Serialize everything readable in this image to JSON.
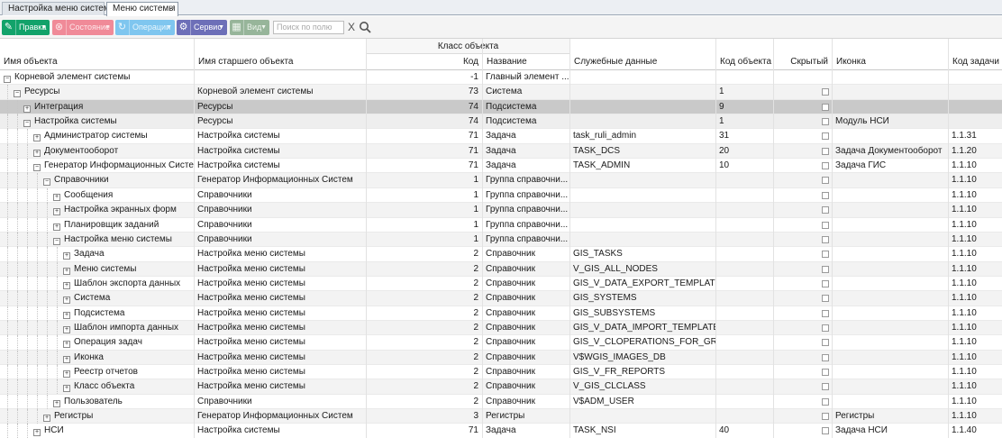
{
  "tabs": [
    {
      "label": "Настройка меню системы"
    },
    {
      "label": "Меню системы",
      "close": "×"
    }
  ],
  "toolbar": {
    "edit": "Правка",
    "state": "Состояние",
    "operations": "Операции",
    "service": "Сервис",
    "view": "Вид",
    "search_placeholder": "Поиск по полю",
    "clear": "X"
  },
  "grid": {
    "group_header": "Класс объекта",
    "columns": [
      "Имя объекта",
      "Имя старшего объекта",
      "Код",
      "Название",
      "Служебные данные",
      "Код объекта",
      "Скрытый",
      "Иконка",
      "Код задачи"
    ],
    "rows": [
      {
        "level": 0,
        "exp": "−",
        "name": "Корневой элемент системы",
        "parent": "",
        "code": "-1",
        "title": "Главный элемент ...",
        "service": "",
        "obj_code": "",
        "icon": "",
        "task": ""
      },
      {
        "level": 1,
        "exp": "−",
        "name": "Ресурсы",
        "parent": "Корневой элемент системы",
        "code": "73",
        "title": "Система",
        "service": "",
        "obj_code": "1",
        "icon": "",
        "task": ""
      },
      {
        "level": 2,
        "exp": "+",
        "name": "Интеграция",
        "parent": "Ресурсы",
        "code": "74",
        "title": "Подсистема",
        "service": "",
        "obj_code": "9",
        "icon": "",
        "task": ""
      },
      {
        "level": 2,
        "exp": "−",
        "name": "Настройка системы",
        "parent": "Ресурсы",
        "code": "74",
        "title": "Подсистема",
        "service": "",
        "obj_code": "1",
        "icon": "Модуль НСИ",
        "task": ""
      },
      {
        "level": 3,
        "exp": "+",
        "name": "Администратор системы",
        "parent": "Настройка системы",
        "code": "71",
        "title": "Задача",
        "service": "task_ruli_admin",
        "obj_code": "31",
        "icon": "",
        "task": "1.1.31"
      },
      {
        "level": 3,
        "exp": "+",
        "name": "Документооборот",
        "parent": "Настройка системы",
        "code": "71",
        "title": "Задача",
        "service": "TASK_DCS",
        "obj_code": "20",
        "icon": "Задача Документооборот",
        "task": "1.1.20"
      },
      {
        "level": 3,
        "exp": "−",
        "name": "Генератор Информационных Систем",
        "parent": "Настройка системы",
        "code": "71",
        "title": "Задача",
        "service": "TASK_ADMIN",
        "obj_code": "10",
        "icon": "Задача ГИС",
        "task": "1.1.10"
      },
      {
        "level": 4,
        "exp": "−",
        "name": "Справочники",
        "parent": "Генератор Информационных Систем",
        "code": "1",
        "title": "Группа справочни...",
        "service": "",
        "obj_code": "",
        "icon": "",
        "task": "1.1.10"
      },
      {
        "level": 5,
        "exp": "+",
        "name": "Сообщения",
        "parent": "Справочники",
        "code": "1",
        "title": "Группа справочни...",
        "service": "",
        "obj_code": "",
        "icon": "",
        "task": "1.1.10"
      },
      {
        "level": 5,
        "exp": "+",
        "name": "Настройка экранных форм",
        "parent": "Справочники",
        "code": "1",
        "title": "Группа справочни...",
        "service": "",
        "obj_code": "",
        "icon": "",
        "task": "1.1.10"
      },
      {
        "level": 5,
        "exp": "+",
        "name": "Планировщик заданий",
        "parent": "Справочники",
        "code": "1",
        "title": "Группа справочни...",
        "service": "",
        "obj_code": "",
        "icon": "",
        "task": "1.1.10"
      },
      {
        "level": 5,
        "exp": "−",
        "name": "Настройка меню системы",
        "parent": "Справочники",
        "code": "1",
        "title": "Группа справочни...",
        "service": "",
        "obj_code": "",
        "icon": "",
        "task": "1.1.10"
      },
      {
        "level": 6,
        "exp": "+",
        "name": "Задача",
        "parent": "Настройка меню системы",
        "code": "2",
        "title": "Справочник",
        "service": "GIS_TASKS",
        "obj_code": "",
        "icon": "",
        "task": "1.1.10"
      },
      {
        "level": 6,
        "exp": "+",
        "name": "Меню системы",
        "parent": "Настройка меню системы",
        "code": "2",
        "title": "Справочник",
        "service": "V_GIS_ALL_NODES",
        "obj_code": "",
        "icon": "",
        "task": "1.1.10"
      },
      {
        "level": 6,
        "exp": "+",
        "name": "Шаблон экспорта данных",
        "parent": "Настройка меню системы",
        "code": "2",
        "title": "Справочник",
        "service": "GIS_V_DATA_EXPORT_TEMPLATE",
        "obj_code": "",
        "icon": "",
        "task": "1.1.10"
      },
      {
        "level": 6,
        "exp": "+",
        "name": "Система",
        "parent": "Настройка меню системы",
        "code": "2",
        "title": "Справочник",
        "service": "GIS_SYSTEMS",
        "obj_code": "",
        "icon": "",
        "task": "1.1.10"
      },
      {
        "level": 6,
        "exp": "+",
        "name": "Подсистема",
        "parent": "Настройка меню системы",
        "code": "2",
        "title": "Справочник",
        "service": "GIS_SUBSYSTEMS",
        "obj_code": "",
        "icon": "",
        "task": "1.1.10"
      },
      {
        "level": 6,
        "exp": "+",
        "name": "Шаблон импорта данных",
        "parent": "Настройка меню системы",
        "code": "2",
        "title": "Справочник",
        "service": "GIS_V_DATA_IMPORT_TEMPLATE",
        "obj_code": "",
        "icon": "",
        "task": "1.1.10"
      },
      {
        "level": 6,
        "exp": "+",
        "name": "Операция задач",
        "parent": "Настройка меню системы",
        "code": "2",
        "title": "Справочник",
        "service": "GIS_V_CLOPERATIONS_FOR_GR...",
        "obj_code": "",
        "icon": "",
        "task": "1.1.10"
      },
      {
        "level": 6,
        "exp": "+",
        "name": "Иконка",
        "parent": "Настройка меню системы",
        "code": "2",
        "title": "Справочник",
        "service": "V$WGIS_IMAGES_DB",
        "obj_code": "",
        "icon": "",
        "task": "1.1.10"
      },
      {
        "level": 6,
        "exp": "+",
        "name": "Реестр отчетов",
        "parent": "Настройка меню системы",
        "code": "2",
        "title": "Справочник",
        "service": "GIS_V_FR_REPORTS",
        "obj_code": "",
        "icon": "",
        "task": "1.1.10"
      },
      {
        "level": 6,
        "exp": "+",
        "name": "Класс объекта",
        "parent": "Настройка меню системы",
        "code": "2",
        "title": "Справочник",
        "service": "V_GIS_CLCLASS",
        "obj_code": "",
        "icon": "",
        "task": "1.1.10"
      },
      {
        "level": 5,
        "exp": "+",
        "name": "Пользователь",
        "parent": "Справочники",
        "code": "2",
        "title": "Справочник",
        "service": "V$ADM_USER",
        "obj_code": "",
        "icon": "",
        "task": "1.1.10"
      },
      {
        "level": 4,
        "exp": "+",
        "name": "Регистры",
        "parent": "Генератор Информационных Систем",
        "code": "3",
        "title": "Регистры",
        "service": "",
        "obj_code": "",
        "icon": "Регистры",
        "task": "1.1.10"
      },
      {
        "level": 3,
        "exp": "+",
        "name": "НСИ",
        "parent": "Настройка системы",
        "code": "71",
        "title": "Задача",
        "service": "TASK_NSI",
        "obj_code": "40",
        "icon": "Задача НСИ",
        "task": "1.1.40"
      }
    ]
  }
}
